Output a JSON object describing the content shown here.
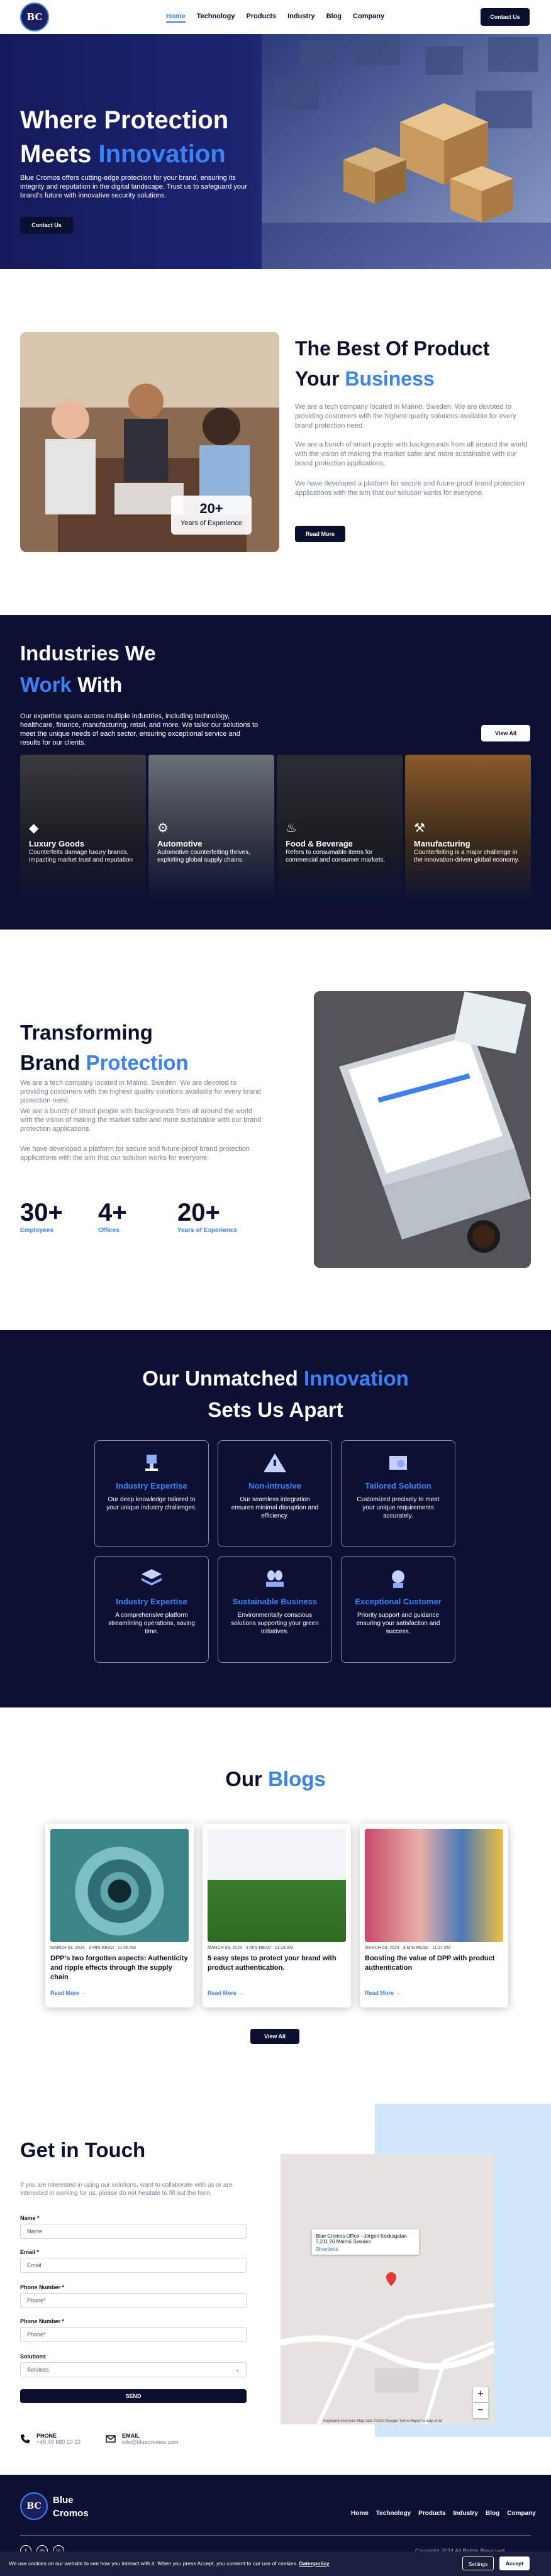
{
  "nav": {
    "logo": "BC",
    "links": [
      "Home",
      "Technology",
      "Products",
      "Industry",
      "Blog",
      "Company"
    ],
    "contact": "Contact Us"
  },
  "hero": {
    "title_1": "Where Protection",
    "title_2a": "Meets ",
    "title_2b": "Innovation",
    "text": "Blue Cromos offers cutting-edge protection for your brand, ensuring its integrity and reputation in the digital landscape. Trust us to safeguard your brand's future with innovative security solutions.",
    "cta": "Contact Us"
  },
  "best": {
    "title_1": "The Best Of Product",
    "title_2a": "Your ",
    "title_2b": "Business",
    "para_1": "We are a tech company located in Malmö, Sweden. We are devoted to providing customers with the highest quality solutions available for every brand protection need.",
    "para_2": "We are a bunch of smart people with backgrounds from all around the world with the vision of making the market safer and more sustainable with our brand protection applications.",
    "para_3": "We have developed a platform for secure and future-proof brand protection applications with the aim that our solution works for everyone.",
    "badge_num": "20+",
    "badge_label": "Years of Experience",
    "read_more": "Read More"
  },
  "industries": {
    "title_1": "Industries We",
    "title_2a": "Work",
    "title_2b": " With",
    "text": "Our expertise spans across multiple industries, including technology, healthcare, finance, manufacturing, retail, and more. We tailor our solutions to meet the unique needs of each sector, ensuring exceptional service and results for our clients.",
    "view_all": "View All",
    "cards": [
      {
        "title": "Luxury Goods",
        "text": "Counterfeits damage luxury brands, impacting market trust and reputation"
      },
      {
        "title": "Automotive",
        "text": "Automotive counterfeiting thrives, exploiting global supply chains."
      },
      {
        "title": "Food & Beverage",
        "text": "Refers to consumable items for commercial and consumer markets."
      },
      {
        "title": "Manufacturing",
        "text": "Counterfeiting is a major challenge in the innovation-driven global economy."
      }
    ]
  },
  "transforming": {
    "title_1": "Transforming",
    "title_2a": "Brand ",
    "title_2b": "Protection",
    "para_1": "We are a tech company located in Malmö, Sweden. We are devoted to providing customers with the highest quality solutions available for every brand protection need.",
    "para_2": "We are a bunch of smart people with backgrounds from all around the world with the vision of making the market safer and more sustainable with our brand protection applications.",
    "para_3": "We have developed a platform for secure and future-proof brand protection applications with the aim that our solution works for everyone.",
    "stats": [
      {
        "value": "30+",
        "label": "Employees"
      },
      {
        "value": "4+",
        "label": "Offices"
      },
      {
        "value": "20+",
        "label": "Years of Experience"
      }
    ]
  },
  "unmatched": {
    "title_1a": "Our Unmatched ",
    "title_1b": "Innovation",
    "title_2": "Sets Us Apart",
    "tiles": [
      {
        "title": "Industry Expertise",
        "text": "Our deep knowledge tailored to your unique industry challenges."
      },
      {
        "title": "Non-intrusive",
        "text": "Our seamless integration ensures minimal disruption and efficiency."
      },
      {
        "title": "Tailored Solution",
        "text": "Customized precisely to meet your unique requirements accurately."
      },
      {
        "title": "Industry Expertise",
        "text": "A comprehensive platform streamlining operations, saving time."
      },
      {
        "title": "Sustainable Business",
        "text": "Environmentally conscious solutions supporting your green initiatives."
      },
      {
        "title": "Exceptional Customer",
        "text": "Priority support and guidance ensuring your satisfaction and success."
      }
    ]
  },
  "blogs": {
    "title_a": "Our ",
    "title_b": "Blogs",
    "view_all": "View All",
    "posts": [
      {
        "date": "MARCH 03, 2024",
        "read": "3 MIN READ",
        "time": "11:46 AM",
        "title": "DPP's two forgotten aspects: Authenticity and ripple effects through the supply chain",
        "more": "Read More →"
      },
      {
        "date": "MARCH 03, 2024",
        "read": "3 MIN READ",
        "time": "11:18 AM",
        "title": "5 easy steps to protect your brand with product authentication.",
        "more": "Read More →"
      },
      {
        "date": "MARCH 03, 2024",
        "read": "3 MIN READ",
        "time": "11:17 AM",
        "title": "Boosting the value of DPP with product authentication",
        "more": "Read More →"
      }
    ]
  },
  "contact": {
    "title": "Get in Touch",
    "intro": "If you are interested in using our solutions, want to collaborate with us or are interested in working for us, please do not hesitate to fill out the form.",
    "fields": [
      {
        "label": "Name *",
        "placeholder": "Name"
      },
      {
        "label": "Email *",
        "placeholder": "Email"
      },
      {
        "label": "Phone Number *",
        "placeholder": "Phone*"
      },
      {
        "label": "Phone Number *",
        "placeholder": "Phone*"
      }
    ],
    "solutions_label": "Solutions",
    "solutions_value": "Services",
    "send": "SEND",
    "phone_label": "PHONE",
    "phone_value": "+46 40 680 20 22",
    "email_label": "EMAIL",
    "email_value": "info@bluecromos.com",
    "map_box_title": "Blue Cromos Office - Jörgen Kocksgatan 7,211 20 Malmö Sweden",
    "map_box_link": "Directions",
    "map_footer": "Keyboard shortcuts   Map data ©2024 Google   Terms   Report a map error"
  },
  "footer": {
    "logo": "BC",
    "brand_1": "Blue",
    "brand_2": "Cromos",
    "links": [
      "Home",
      "Technology",
      "Products",
      "Industry",
      "Blog",
      "Company"
    ],
    "copyright": "Copyright 2024 All Rights Reserved"
  },
  "cookie": {
    "text": "We use cookies on our website to see how you interact with it. When you press Accept, you consent to our use of cookies.",
    "policy": "Datenpolicy",
    "settings": "Settings",
    "accept": "Accept"
  },
  "colors": {
    "accent": "#3b82f6",
    "navy": "#0c1133"
  }
}
